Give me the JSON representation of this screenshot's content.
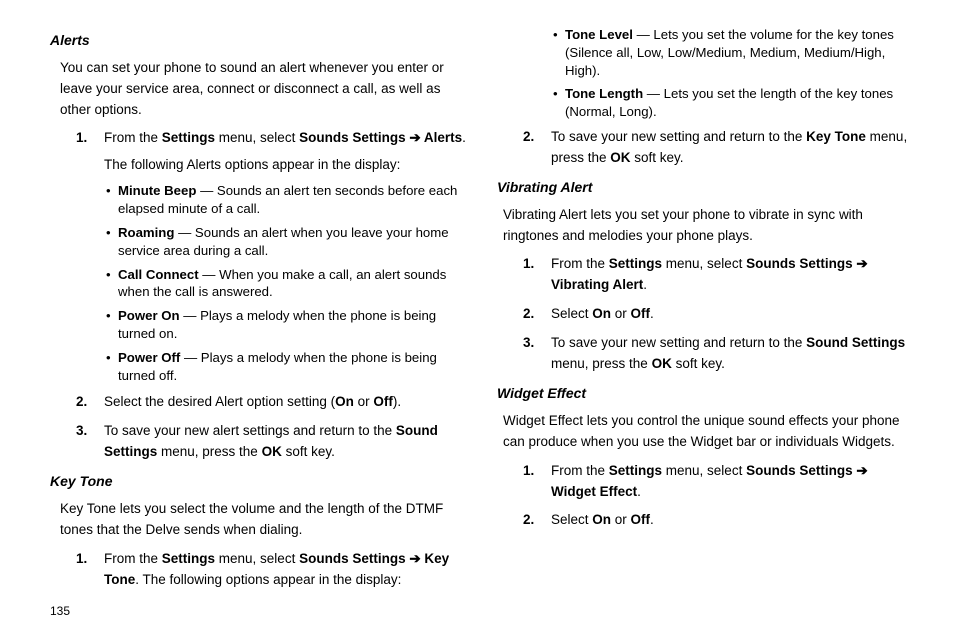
{
  "page_number": "135",
  "arrow": "➔",
  "col_left": {
    "alerts_heading": "Alerts",
    "alerts_intro": "You can set your phone to sound an alert whenever you enter or leave your service area, connect or disconnect a call, as well as other options.",
    "alerts_step1_a": "From the ",
    "alerts_step1_b": "Settings",
    "alerts_step1_c": " menu, select ",
    "alerts_step1_d": "Sounds Settings ",
    "alerts_step1_e": " Alerts",
    "alerts_step1_f": ".",
    "alerts_step1_para": "The following Alerts options appear in the display:",
    "bullets": [
      {
        "b": "Minute Beep",
        "t": " — Sounds an alert ten seconds before each elapsed minute of a call."
      },
      {
        "b": "Roaming",
        "t": " — Sounds an alert when you leave your home service area during a call."
      },
      {
        "b": "Call Connect",
        "t": " — When you make a call, an alert sounds when the call is answered."
      },
      {
        "b": "Power On",
        "t": " — Plays a melody when the phone is being turned on."
      },
      {
        "b": "Power Off",
        "t": " — Plays a melody when the phone is being turned off."
      }
    ],
    "alerts_step2_a": "Select the desired Alert option setting (",
    "alerts_step2_b": "On",
    "alerts_step2_c": " or ",
    "alerts_step2_d": "Off",
    "alerts_step2_e": ").",
    "alerts_step3_a": "To save your new alert settings and return to the ",
    "alerts_step3_b": "Sound Settings",
    "alerts_step3_c": " menu, press the ",
    "alerts_step3_d": "OK",
    "alerts_step3_e": " soft key.",
    "keytone_heading": "Key Tone",
    "keytone_intro": "Key Tone lets you select the volume and the length of the DTMF tones that the Delve sends when dialing.",
    "keytone_step1_a": "From the ",
    "keytone_step1_b": "Settings",
    "keytone_step1_c": " menu, select ",
    "keytone_step1_d": "Sounds Settings ",
    "keytone_step1_e": " Key Tone",
    "keytone_step1_f": ". The following options appear in the display:"
  },
  "col_right": {
    "kt_bullets": [
      {
        "b": "Tone Level",
        "t": " — Lets you set the volume for the key tones (Silence all, Low, Low/Medium, Medium, Medium/High, High)."
      },
      {
        "b": "Tone Length",
        "t": " — Lets you set the length of the key tones (Normal, Long)."
      }
    ],
    "kt_step2_a": "To save your new setting and return to the ",
    "kt_step2_b": "Key Tone",
    "kt_step2_c": " menu, press the ",
    "kt_step2_d": "OK",
    "kt_step2_e": " soft key.",
    "vib_heading": "Vibrating Alert",
    "vib_intro": "Vibrating Alert lets you set your phone to vibrate in sync with ringtones and melodies your phone plays.",
    "vib_step1_a": "From the ",
    "vib_step1_b": "Settings",
    "vib_step1_c": " menu, select ",
    "vib_step1_d": "Sounds Settings ",
    "vib_step1_e": " Vibrating Alert",
    "vib_step1_f": ".",
    "vib_step2_a": "Select ",
    "vib_step2_b": "On",
    "vib_step2_c": " or ",
    "vib_step2_d": "Off",
    "vib_step2_e": ".",
    "vib_step3_a": "To save your new setting and return to the ",
    "vib_step3_b": "Sound Settings",
    "vib_step3_c": " menu, press the ",
    "vib_step3_d": "OK",
    "vib_step3_e": " soft key.",
    "widget_heading": "Widget Effect",
    "widget_intro": "Widget Effect lets you control the unique sound effects your phone can produce when you use the Widget bar or individuals Widgets.",
    "widget_step1_a": "From the ",
    "widget_step1_b": "Settings",
    "widget_step1_c": " menu, select ",
    "widget_step1_d": "Sounds Settings ",
    "widget_step1_e": " Widget Effect",
    "widget_step1_f": ".",
    "widget_step2_a": "Select ",
    "widget_step2_b": "On",
    "widget_step2_c": " or ",
    "widget_step2_d": "Off",
    "widget_step2_e": "."
  }
}
